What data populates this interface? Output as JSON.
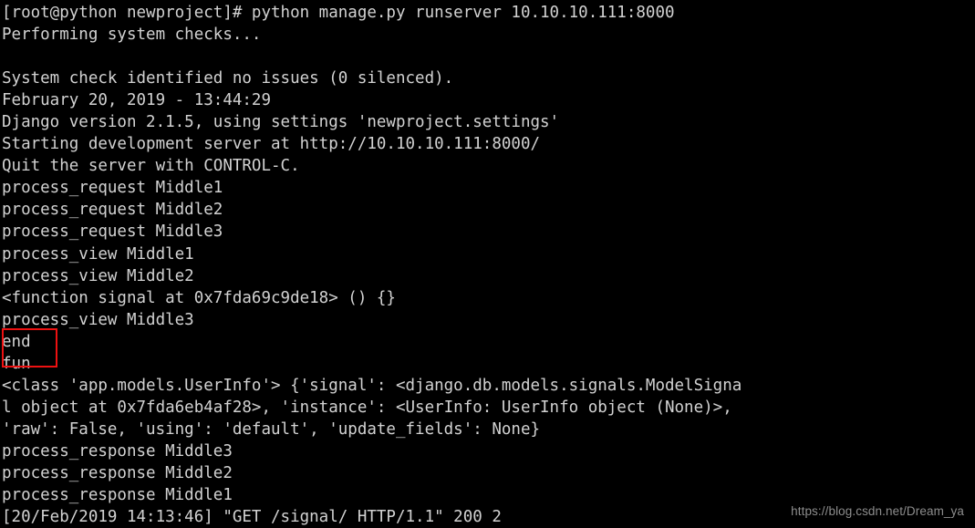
{
  "terminal": {
    "title": "python manage.py runserver terminal output",
    "background_color": "#000000",
    "text_color": "#d2d2d2",
    "annotation_color": "#ee1111",
    "lines": [
      "[root@python newproject]# python manage.py runserver 10.10.10.111:8000",
      "Performing system checks...",
      "",
      "System check identified no issues (0 silenced).",
      "February 20, 2019 - 13:44:29",
      "Django version 2.1.5, using settings 'newproject.settings'",
      "Starting development server at http://10.10.10.111:8000/",
      "Quit the server with CONTROL-C.",
      "process_request Middle1",
      "process_request Middle2",
      "process_request Middle3",
      "process_view Middle1",
      "process_view Middle2",
      "<function signal at 0x7fda69c9de18> () {}",
      "process_view Middle3",
      "end",
      "fun",
      "<class 'app.models.UserInfo'> {'signal': <django.db.models.signals.ModelSigna",
      "l object at 0x7fda6eb4af28>, 'instance': <UserInfo: UserInfo object (None)>,",
      "'raw': False, 'using': 'default', 'update_fields': None}",
      "process_response Middle3",
      "process_response Middle2",
      "process_response Middle1",
      "[20/Feb/2019 14:13:46] \"GET /signal/ HTTP/1.1\" 200 2"
    ]
  },
  "annotation": {
    "label": "red-highlight-box",
    "covers": [
      "end",
      "fun"
    ]
  },
  "watermark": {
    "text": "https://blog.csdn.net/Dream_ya"
  }
}
